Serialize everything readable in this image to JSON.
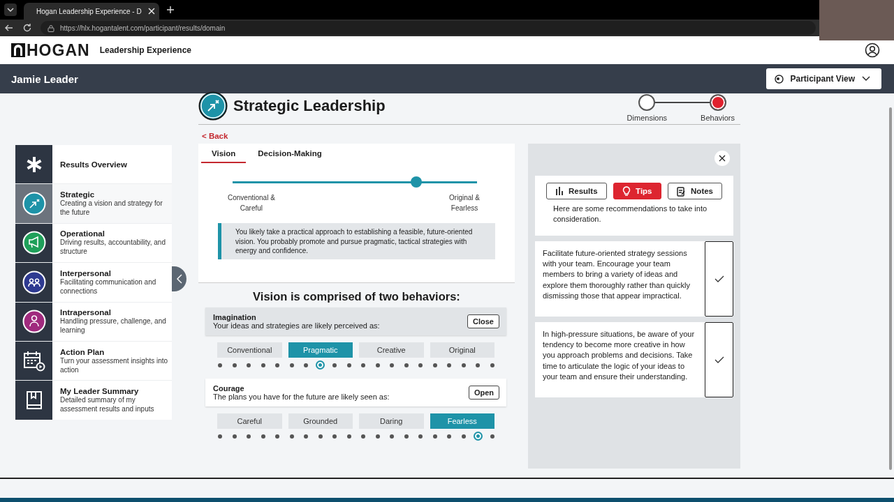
{
  "browser": {
    "tab_title": "Hogan Leadership Experience - D",
    "url": "https://hlx.hogantalent.com/participant/results/domain"
  },
  "header": {
    "brand": "HOGAN",
    "product": "Leadership Experience"
  },
  "user_bar": {
    "name": "Jamie Leader",
    "view_button": "Participant View"
  },
  "sidebar": {
    "items": [
      {
        "kind": "overview",
        "title": "Results Overview",
        "selected": false
      },
      {
        "kind": "domain",
        "color": "#1e93a8",
        "title": "Strategic",
        "description": "Creating a vision and strategy for the future",
        "selected": true
      },
      {
        "kind": "domain",
        "color": "#1fa05a",
        "title": "Operational",
        "description": "Driving results, accountability, and structure",
        "selected": false
      },
      {
        "kind": "domain",
        "color": "#2e3a91",
        "title": "Interpersonal",
        "description": "Facilitating communication and connections",
        "selected": false
      },
      {
        "kind": "domain",
        "color": "#a02a7e",
        "title": "Intrapersonal",
        "description": "Handling pressure, challenge, and learning",
        "selected": false
      },
      {
        "kind": "plan",
        "title": "Action Plan",
        "description": "Turn your assessment insights into action",
        "selected": false
      },
      {
        "kind": "summary",
        "title": "My Leader Summary",
        "description": "Detailed summary of my assessment results and inputs",
        "selected": false
      }
    ]
  },
  "page": {
    "title": "Strategic Leadership",
    "steps": [
      {
        "label": "Dimensions",
        "selected": false
      },
      {
        "label": "Behaviors",
        "selected": true
      }
    ],
    "back_link": "< Back"
  },
  "dimension_tabs": [
    {
      "label": "Vision",
      "selected": true
    },
    {
      "label": "Decision-Making",
      "selected": false
    }
  ],
  "scale": {
    "level": 0.75,
    "left_label": "Conventional &\nCareful",
    "right_label": "Original &\nFearless"
  },
  "summary": "You likely take a practical approach to establishing a feasible, future-oriented vision. You probably promote and pursue pragmatic, tactical strategies with energy and confidence.",
  "behaviors_heading": "Vision is comprised of two behaviors:",
  "behaviors": [
    {
      "name": "Imagination",
      "prompt": "Your ideas and strategies are likely perceived as:",
      "button": "Close",
      "expanded": true,
      "level": 0.368,
      "options": [
        {
          "label": "Conventional",
          "selected": false
        },
        {
          "label": "Pragmatic",
          "selected": true
        },
        {
          "label": "Creative",
          "selected": false
        },
        {
          "label": "Original",
          "selected": false
        }
      ]
    },
    {
      "name": "Courage",
      "prompt": "The plans you have for the future are likely seen as:",
      "button": "Open",
      "expanded": false,
      "level": 0.947,
      "options": [
        {
          "label": "Careful",
          "selected": false
        },
        {
          "label": "Grounded",
          "selected": false
        },
        {
          "label": "Daring",
          "selected": false
        },
        {
          "label": "Fearless",
          "selected": true
        }
      ]
    }
  ],
  "side_panel": {
    "tabs": [
      {
        "kind": "results",
        "label": "Results",
        "selected": false
      },
      {
        "kind": "tips",
        "label": "Tips",
        "selected": true
      },
      {
        "kind": "notes",
        "label": "Notes",
        "selected": false
      }
    ],
    "intro": "Here are some recommendations to take into consideration.",
    "tips": [
      "Facilitate future-oriented strategy sessions with your team. Encourage your team members to bring a variety of ideas and explore them thoroughly rather than quickly dismissing those that appear impractical.",
      "In high-pressure situations, be aware of your tendency to become more creative in how you approach problems and decisions. Take time to articulate the logic of your ideas to your team and ensure their understanding."
    ]
  }
}
